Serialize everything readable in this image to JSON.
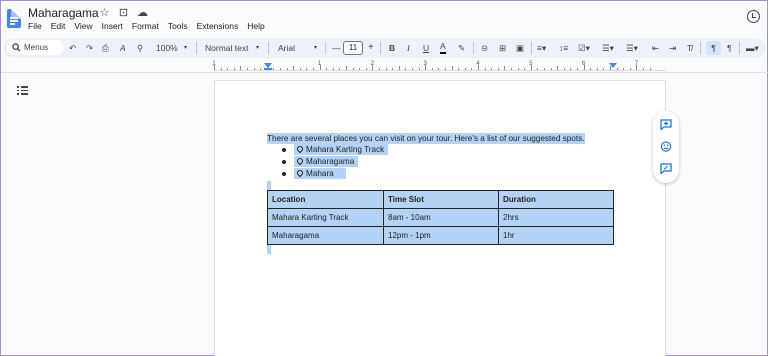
{
  "window": {
    "doc_title": "Maharagama",
    "title_icons": [
      "☆",
      "⊡",
      "☁"
    ],
    "menu": [
      "File",
      "Edit",
      "View",
      "Insert",
      "Format",
      "Tools",
      "Extensions",
      "Help"
    ]
  },
  "toolbar": {
    "menus_label": "Menus",
    "undo": "↶",
    "redo": "↷",
    "print": "⎙",
    "spellcheck": "A",
    "paint_format": "⚲",
    "zoom": "100%",
    "zoom_caret": "▾",
    "style": "Normal text",
    "style_caret": "▾",
    "font": "Arial",
    "font_caret": "▾",
    "decrease": "—",
    "font_size": "11",
    "increase": "+",
    "bold": "B",
    "italic": "I",
    "underline": "U",
    "text_color": "A",
    "highlight": "✎",
    "link": "⊝",
    "comment": "⊞",
    "image": "▣",
    "align": "≡▾",
    "line_spacing": "↕≡",
    "checklist": "☑▾",
    "bullets": "☰▾",
    "numbered": "☰▾",
    "indent_less": "⇤",
    "indent_more": "⇥",
    "clear_format": "T̸",
    "ltr": "¶",
    "rtl": "¶",
    "more": "▬▾"
  },
  "ruler": {
    "numbers": [
      "1",
      "1",
      "2",
      "3",
      "4",
      "5",
      "6",
      "7"
    ]
  },
  "document": {
    "intro": "There are several places you can visit on your tour. Here’s a list of our suggested spots.",
    "places": [
      "Mahara Karting Track",
      "Maharagama",
      "Mahara"
    ],
    "table": {
      "headers": [
        "Location",
        "Time Slot",
        "Duration"
      ],
      "rows": [
        [
          "Mahara Karting Track",
          "8am - 10am",
          "2hrs"
        ],
        [
          "Maharagama",
          "12pm - 1pm",
          "1hr"
        ]
      ]
    }
  },
  "colors": {
    "accent": "#1a73e8",
    "selection": "#b4d2f4",
    "toolbar_bg": "#edf2fa",
    "doc_blue": "#4285f4"
  }
}
